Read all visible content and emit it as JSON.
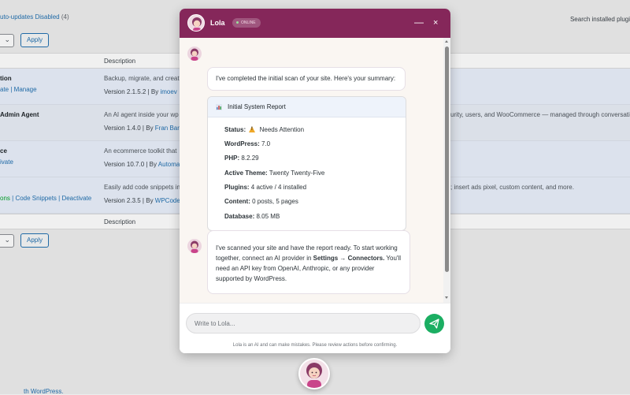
{
  "background": {
    "filter_text": "uto-updates Disabled",
    "filter_count": "(4)",
    "search_label": "Search installed plugi",
    "apply_label": "Apply",
    "description_header": "Description",
    "plugins": [
      {
        "name": "tion",
        "actions": [
          "ate",
          "Manage"
        ],
        "description": "Backup, migrate, and creat",
        "version": "Version 2.1.5.2",
        "by": "imoev"
      },
      {
        "name": "Admin Agent",
        "actions": [],
        "description": "An AI agent inside your wp",
        "version": "Version 1.4.0",
        "by": "Fran Barb"
      },
      {
        "name": "ce",
        "actions": [
          "ivate"
        ],
        "description": "An ecommerce toolkit that",
        "version": "Version 10.7.0",
        "by": "Automa"
      },
      {
        "name": "",
        "actions": [
          "ons",
          "Code Snippets",
          "Deactivate"
        ],
        "description": "Easily add code snippets in",
        "version": "Version 2.3.5",
        "by": "WPCode"
      }
    ],
    "right_texts": [
      "urity, users, and WooCommerce — managed through conversati",
      "; insert ads pixel, custom content, and more."
    ],
    "footer_link": "th WordPress."
  },
  "chat": {
    "title": "Lola",
    "status": "ONLINE",
    "minimize_label": "—",
    "close_label": "×",
    "messages": {
      "intro": "I've completed the initial scan of your site. Here's your summary:",
      "report_title": "Initial System Report",
      "report": [
        {
          "label": "Status:",
          "value": "Needs Attention",
          "warn": true
        },
        {
          "label": "WordPress:",
          "value": "7.0"
        },
        {
          "label": "PHP:",
          "value": "8.2.29"
        },
        {
          "label": "Active Theme:",
          "value": "Twenty Twenty-Five"
        },
        {
          "label": "Plugins:",
          "value": "4 active / 4 installed"
        },
        {
          "label": "Content:",
          "value": "0 posts, 5 pages"
        },
        {
          "label": "Database:",
          "value": "8.05 MB"
        }
      ],
      "followup_part1": "I've scanned your site and have the report ready. To start working together, connect an AI provider in ",
      "followup_bold": "Settings → Connectors.",
      "followup_part2": " You'll need an API key from OpenAI, Anthropic, or any provider supported by WordPress."
    },
    "input_placeholder": "Write to Lola...",
    "disclaimer": "Lola is an AI and can make mistakes. Please review actions before confirming."
  },
  "colors": {
    "header": "#85275a",
    "send": "#1bae62",
    "link": "#2271b1",
    "warning": "#f0a92a"
  }
}
